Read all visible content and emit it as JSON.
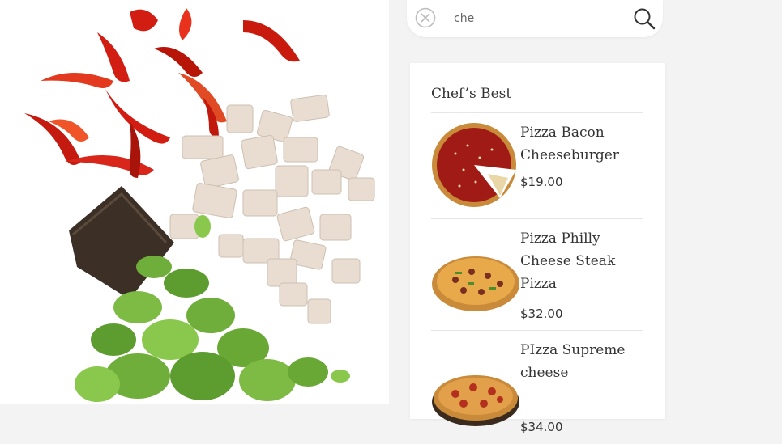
{
  "search": {
    "query": "che",
    "clear_icon": "close-circle-icon",
    "submit_icon": "search-icon"
  },
  "results": {
    "section_title": "Chef’s Best",
    "items": [
      {
        "name": "Pizza Bacon Cheeseburger",
        "price": "$19.00"
      },
      {
        "name": "Pizza Philly Cheese Steak Pizza",
        "price": "$32.00"
      },
      {
        "name": "PIzza Supreme cheese",
        "price": "$34.00"
      }
    ]
  },
  "colors": {
    "page_background": "#f3f3f3",
    "card_background": "#ffffff",
    "text": "#333333"
  }
}
